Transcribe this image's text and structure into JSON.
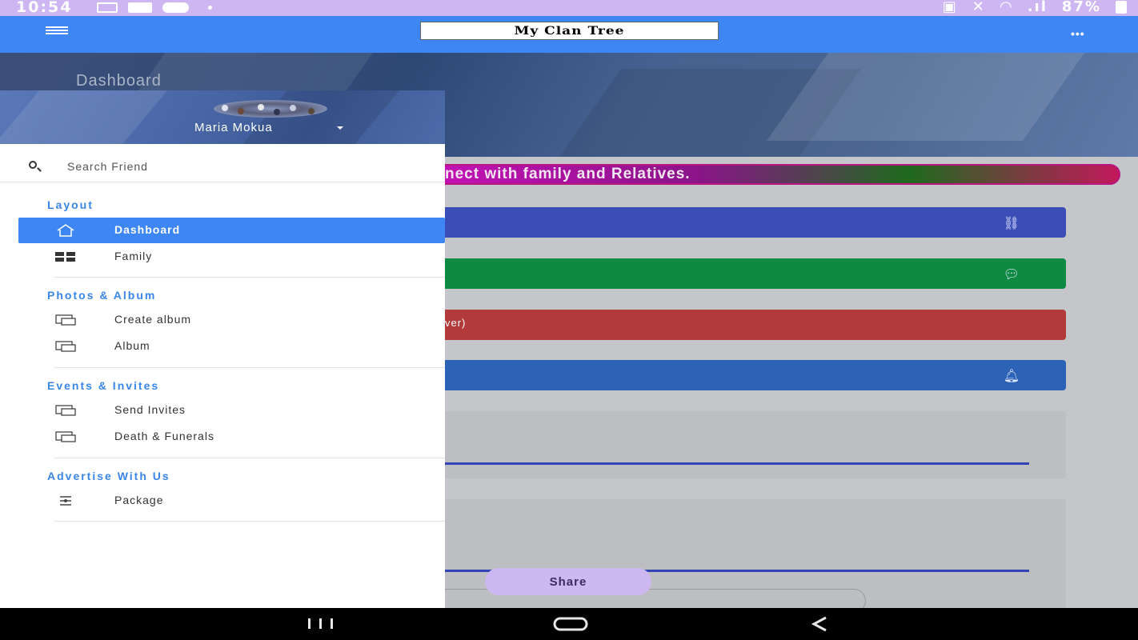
{
  "status_bar": {
    "time": "10:54",
    "battery": "87%"
  },
  "app_bar": {
    "title": "My Clan Tree"
  },
  "banner": {
    "title": "Dashboard"
  },
  "marquee": {
    "text": "nect with family and Relatives."
  },
  "cards": [
    {
      "text": "",
      "icon": "link-icon",
      "color": "#3b4db6"
    },
    {
      "text": "",
      "icon": "chat-icon",
      "color": "#0f8a43"
    },
    {
      "text": "ver)",
      "icon": "",
      "color": "#b23a3a"
    },
    {
      "text": "",
      "icon": "bell-icon",
      "color": "#2c63b7"
    }
  ],
  "share_button": {
    "label": "Share"
  },
  "drawer": {
    "user_name": "Maria Mokua",
    "search_placeholder": "Search Friend",
    "sections": [
      {
        "title": "Layout",
        "items": [
          {
            "label": "Dashboard",
            "icon": "home-icon",
            "active": true
          },
          {
            "label": "Family",
            "icon": "grid-icon",
            "active": false
          }
        ]
      },
      {
        "title": "Photos & Album",
        "items": [
          {
            "label": "Create album",
            "icon": "monitor-icon",
            "active": false
          },
          {
            "label": "Album",
            "icon": "monitor-icon",
            "active": false
          }
        ]
      },
      {
        "title": "Events & Invites",
        "items": [
          {
            "label": "Send Invites",
            "icon": "monitor-icon",
            "active": false
          },
          {
            "label": "Death & Funerals",
            "icon": "monitor-icon",
            "active": false
          }
        ]
      },
      {
        "title": "Advertise With Us",
        "items": [
          {
            "label": "Package",
            "icon": "package-icon",
            "active": false
          }
        ]
      }
    ]
  },
  "colors": {
    "status_bar": "#cdb6f2",
    "app_bar": "#3f86f5",
    "drawer_active": "#3d86f3",
    "section_title": "#3a86e8"
  }
}
